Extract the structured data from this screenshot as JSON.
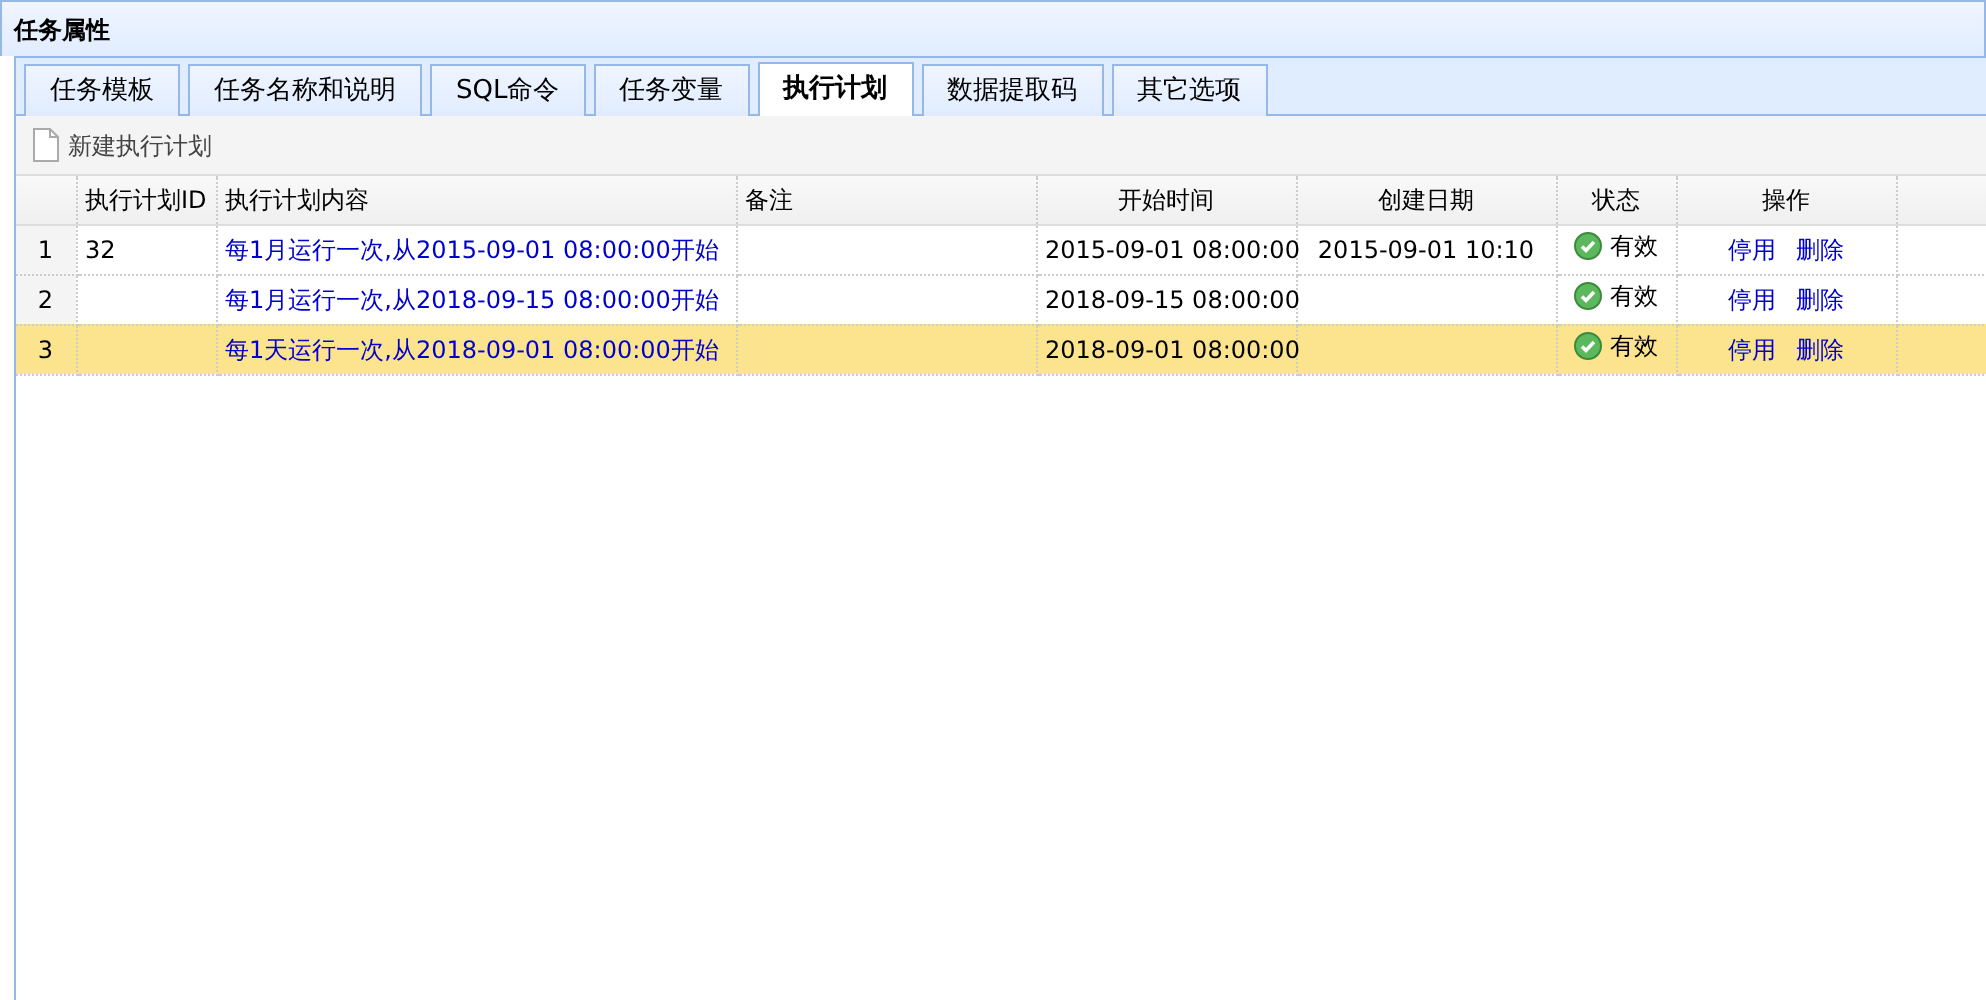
{
  "window": {
    "title": "任务属性"
  },
  "tabs": [
    {
      "label": "任务模板",
      "selected": false
    },
    {
      "label": "任务名称和说明",
      "selected": false
    },
    {
      "label": "SQL命令",
      "selected": false
    },
    {
      "label": "任务变量",
      "selected": false
    },
    {
      "label": "执行计划",
      "selected": true
    },
    {
      "label": "数据提取码",
      "selected": false
    },
    {
      "label": "其它选项",
      "selected": false
    }
  ],
  "toolbar": {
    "new_button": "新建执行计划"
  },
  "table": {
    "columns": [
      "执行计划ID",
      "执行计划内容",
      "备注",
      "开始时间",
      "创建日期",
      "状态",
      "操作"
    ],
    "rows": [
      {
        "number": "1",
        "id": "32",
        "content": "每1月运行一次,从2015-09-01 08:00:00开始",
        "note": "",
        "start": "2015-09-01 08:00:00",
        "created": "2015-09-01 10:10",
        "status": "有效",
        "actions": [
          "停用",
          "删除"
        ],
        "selected": false
      },
      {
        "number": "2",
        "id": "",
        "content": "每1月运行一次,从2018-09-15 08:00:00开始",
        "note": "",
        "start": "2018-09-15 08:00:00",
        "created": "",
        "status": "有效",
        "actions": [
          "停用",
          "删除"
        ],
        "selected": false
      },
      {
        "number": "3",
        "id": "",
        "content": "每1天运行一次,从2018-09-01 08:00:00开始",
        "note": "",
        "start": "2018-09-01 08:00:00",
        "created": "",
        "status": "有效",
        "actions": [
          "停用",
          "删除"
        ],
        "selected": true
      }
    ]
  }
}
